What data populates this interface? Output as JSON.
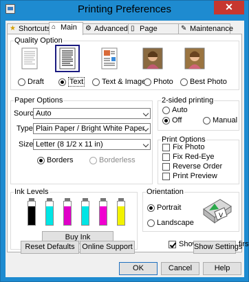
{
  "window": {
    "title": "Printing Preferences",
    "close_glyph": "✕"
  },
  "tabs": [
    {
      "label": "Shortcuts",
      "icon": "star-icon"
    },
    {
      "label": "Main",
      "icon": "home-icon"
    },
    {
      "label": "Advanced",
      "icon": "gear-icon"
    },
    {
      "label": "Page Layout",
      "icon": "page-layout-icon"
    },
    {
      "label": "Maintenance",
      "icon": "wrench-icon"
    }
  ],
  "quality": {
    "label": "Quality Option",
    "options": [
      {
        "label": "Draft",
        "selected": false
      },
      {
        "label": "Text",
        "selected": true
      },
      {
        "label": "Text & Image",
        "selected": false
      },
      {
        "label": "Photo",
        "selected": false
      },
      {
        "label": "Best Photo",
        "selected": false
      }
    ]
  },
  "paper": {
    "label": "Paper Options",
    "source_label": "Source",
    "source_value": "Auto",
    "type_label": "Type",
    "type_value": "Plain Paper / Bright White Paper",
    "size_label": "Size",
    "size_value": "Letter (8 1/2 x 11 in)",
    "borders_label": "Borders",
    "borderless_label": "Borderless",
    "borders_selected": true
  },
  "two_sided": {
    "label": "2-sided printing",
    "auto_label": "Auto",
    "off_label": "Off",
    "manual_label": "Manual",
    "selected": "Off"
  },
  "print_options": {
    "label": "Print Options",
    "items": [
      {
        "label": "Fix Photo",
        "checked": false
      },
      {
        "label": "Fix Red-Eye",
        "checked": false
      },
      {
        "label": "Reverse Order",
        "checked": false
      },
      {
        "label": "Print Preview",
        "checked": false
      }
    ]
  },
  "ink": {
    "label": "Ink Levels",
    "cartridges": [
      {
        "color": "#000000",
        "level": 0.8
      },
      {
        "color": "#00e5e5",
        "level": 0.8
      },
      {
        "color": "#e000c8",
        "level": 0.8
      },
      {
        "color": "#00e5e5",
        "level": 0.8
      },
      {
        "color": "#f000d0",
        "level": 0.8
      },
      {
        "color": "#f2f200",
        "level": 0.8
      }
    ],
    "buy_label": "Buy Ink"
  },
  "orientation": {
    "label": "Orientation",
    "portrait_label": "Portrait",
    "landscape_label": "Landscape",
    "selected": "Portrait",
    "preview_letter": "V"
  },
  "show_screen_first": {
    "label": "Show this screen first",
    "checked": true
  },
  "lower_buttons": {
    "reset": "Reset Defaults",
    "support": "Online Support",
    "show_settings": "Show Settings"
  },
  "dialog_buttons": {
    "ok": "OK",
    "cancel": "Cancel",
    "help": "Help"
  }
}
